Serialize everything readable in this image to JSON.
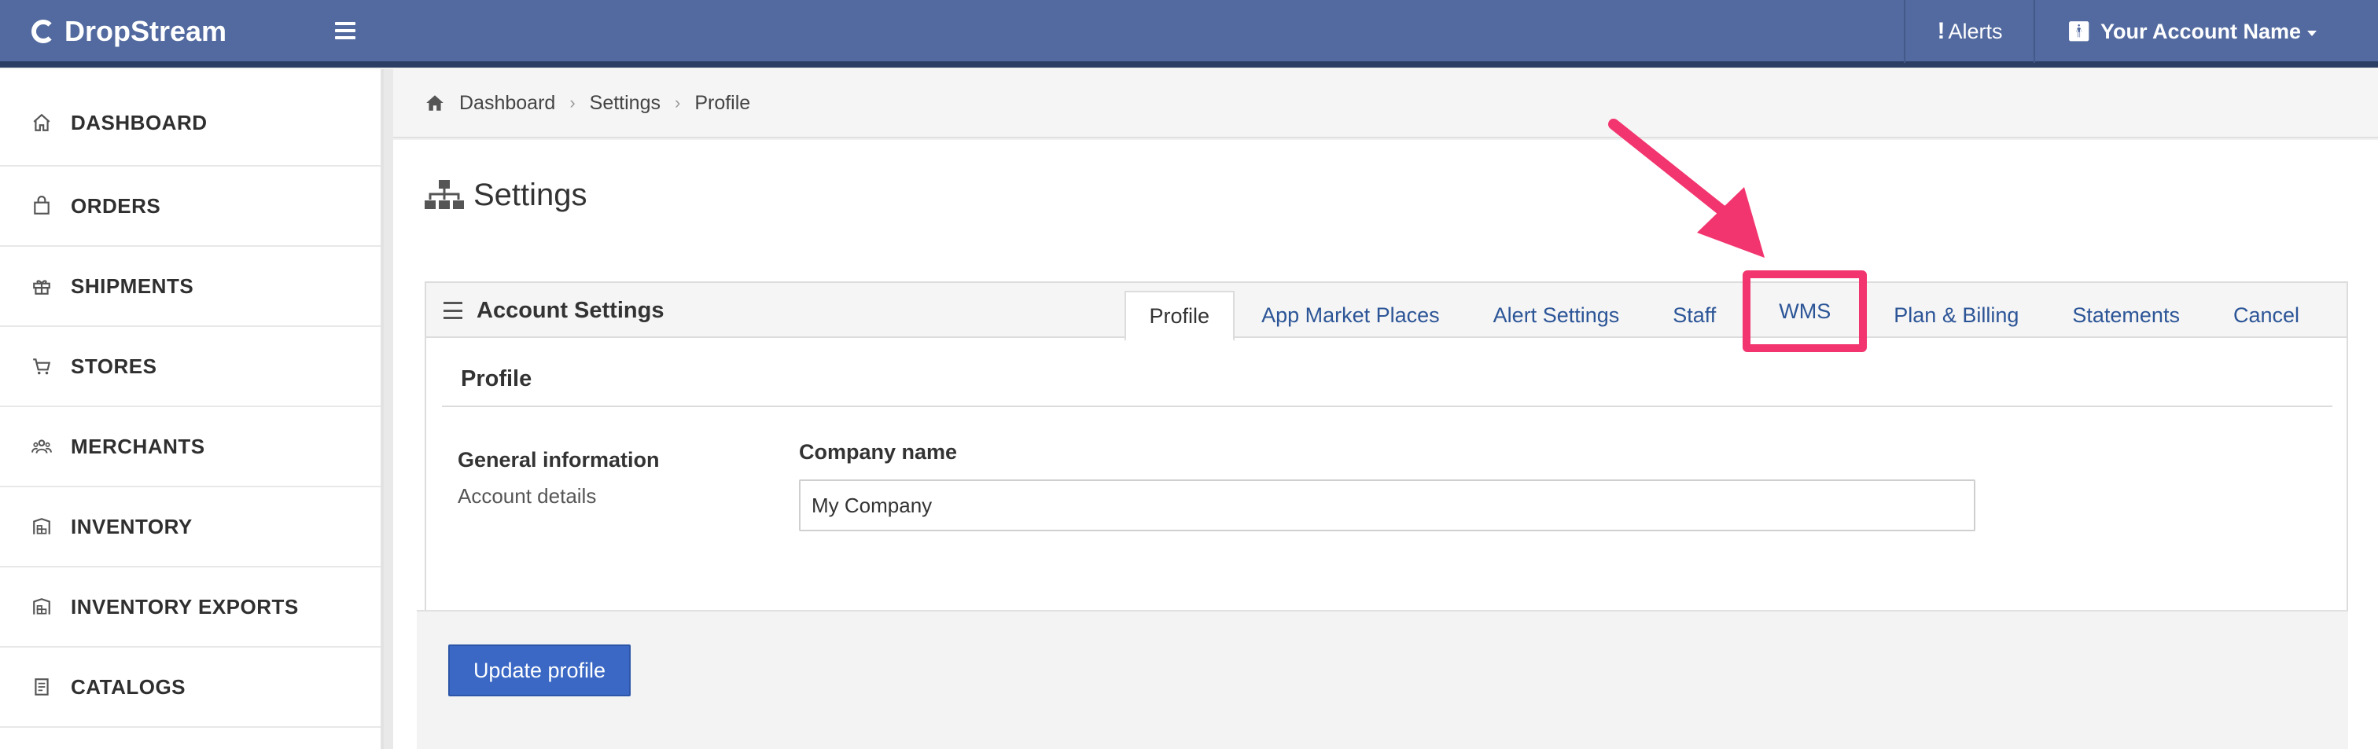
{
  "app": {
    "brand": "DropStream",
    "alerts_label": "Alerts",
    "account_label": "Your Account Name"
  },
  "sidebar": {
    "items": [
      {
        "label": "DASHBOARD",
        "icon": "home-icon"
      },
      {
        "label": "ORDERS",
        "icon": "bag-icon"
      },
      {
        "label": "SHIPMENTS",
        "icon": "gift-icon"
      },
      {
        "label": "STORES",
        "icon": "cart-icon"
      },
      {
        "label": "MERCHANTS",
        "icon": "users-icon"
      },
      {
        "label": "INVENTORY",
        "icon": "warehouse-icon"
      },
      {
        "label": "INVENTORY EXPORTS",
        "icon": "warehouse-icon"
      },
      {
        "label": "CATALOGS",
        "icon": "book-icon"
      }
    ]
  },
  "breadcrumb": [
    "Dashboard",
    "Settings",
    "Profile"
  ],
  "page": {
    "title": "Settings"
  },
  "panel": {
    "title": "Account Settings",
    "tabs": [
      {
        "label": "Profile",
        "active": true
      },
      {
        "label": "App Market Places"
      },
      {
        "label": "Alert Settings"
      },
      {
        "label": "Staff"
      },
      {
        "label": "WMS",
        "highlighted": true
      },
      {
        "label": "Plan & Billing"
      },
      {
        "label": "Statements"
      },
      {
        "label": "Cancel"
      }
    ],
    "section_title": "Profile",
    "info_label": "General information",
    "info_sub": "Account details",
    "field_label": "Company name",
    "field_value": "My Company",
    "update_button": "Update profile"
  },
  "colors": {
    "navbar": "#526a9f",
    "highlight": "#f2356f",
    "primary_button": "#3a68c4",
    "link": "#2c5597"
  }
}
